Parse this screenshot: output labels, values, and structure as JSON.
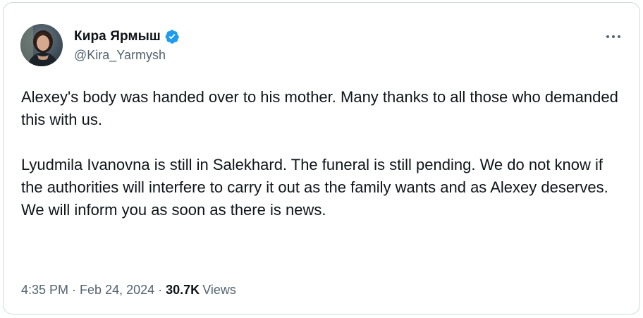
{
  "author": {
    "display_name": "Кира Ярмыш",
    "handle": "@Kira_Yarmysh",
    "verified_icon": "verified-badge-icon",
    "verified_color": "#1d9bf0"
  },
  "tweet": {
    "paragraph_1": "Alexey's body was handed over to his mother. Many thanks to all those who demanded this with us.",
    "paragraph_2": "Lyudmila Ivanovna is still in Salekhard. The funeral is still pending. We do not know if the authorities will interfere to carry it out as the family wants and as Alexey deserves. We will inform you as soon as there is news."
  },
  "meta": {
    "time": "4:35 PM",
    "separator": "·",
    "date": "Feb 24, 2024",
    "views_count": "30.7K",
    "views_label": "Views"
  },
  "menu_icon": "more-options-icon",
  "colors": {
    "text": "#0f1419",
    "secondary": "#536471",
    "border": "#cfd9de"
  }
}
